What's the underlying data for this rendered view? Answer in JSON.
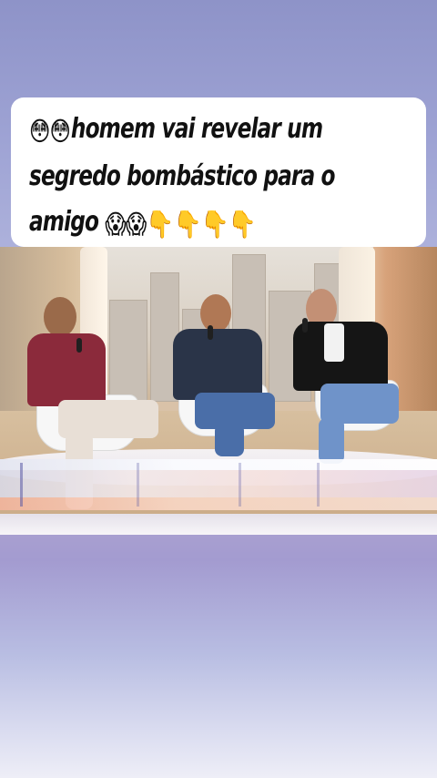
{
  "caption": {
    "lines": [
      {
        "emojis_before": "😳😳",
        "text": "homem vai revelar um",
        "emojis_after": ""
      },
      {
        "emojis_before": "",
        "text": "segredo bombástico para o",
        "emojis_after": ""
      },
      {
        "emojis_before": "",
        "text": "amigo",
        "emojis_after": "😱😱👇👇👇👇"
      }
    ]
  },
  "video": {
    "scene": "three men seated on white chairs in a TV studio, holding microphones",
    "colors": {
      "shirt_left": "#8b2a3b",
      "jacket_middle": "#2a3448",
      "jacket_right": "#151515",
      "jeans": "#4a6ea8",
      "pants_left": "#e8dfd6"
    }
  }
}
